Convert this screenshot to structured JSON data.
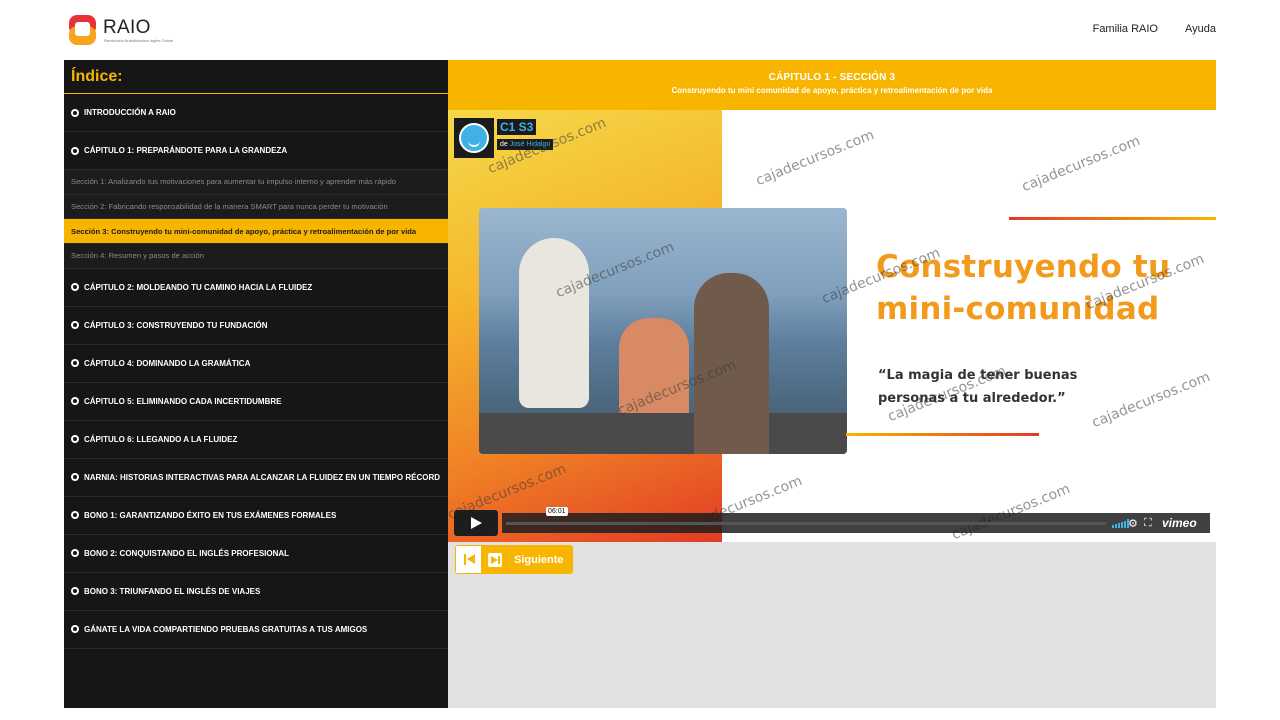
{
  "header": {
    "brand": "RAIO",
    "tagline": "Revolución Autodidáctica Inglés Online",
    "nav": [
      "Familia RAIO",
      "Ayuda"
    ]
  },
  "sidebar": {
    "title": "Índice:",
    "items": [
      {
        "type": "chapter",
        "label": "INTRODUCCIÓN A RAIO"
      },
      {
        "type": "chapter",
        "label": "CÁPITULO 1: PREPARÁNDOTE PARA LA GRANDEZA"
      },
      {
        "type": "section",
        "label": "Sección 1: Analizando tus motivaciones para aumentar tu impulso interno y aprender más rápido"
      },
      {
        "type": "section",
        "label": "Sección 2: Fabricando responsabilidad de la manera SMART para nunca perder tu motivación"
      },
      {
        "type": "section",
        "label": "Sección 3: Construyendo tu mini-comunidad de apoyo, práctica y retroalimentación de por vida",
        "active": true
      },
      {
        "type": "section",
        "label": "Sección 4: Resumen y pasos de acción"
      },
      {
        "type": "chapter",
        "label": "CÁPITULO 2: MOLDEANDO TU CAMINO HACIA LA FLUIDEZ"
      },
      {
        "type": "chapter",
        "label": "CÁPITULO 3: CONSTRUYENDO TU FUNDACIÓN"
      },
      {
        "type": "chapter",
        "label": "CÁPITULO 4: DOMINANDO LA GRAMÁTICA"
      },
      {
        "type": "chapter",
        "label": "CÁPITULO 5: ELIMINANDO CADA INCERTIDUMBRE"
      },
      {
        "type": "chapter",
        "label": "CÁPITULO 6: LLEGANDO A LA FLUIDEZ"
      },
      {
        "type": "chapter",
        "label": "NARNIA: HISTORIAS INTERACTIVAS PARA ALCANZAR LA FLUIDEZ EN UN TIEMPO RÉCORD"
      },
      {
        "type": "chapter",
        "label": "BONO 1: GARANTIZANDO ÉXITO EN TUS EXÁMENES FORMALES"
      },
      {
        "type": "chapter",
        "label": "BONO 2: CONQUISTANDO EL INGLÉS PROFESIONAL"
      },
      {
        "type": "chapter",
        "label": "BONO 3: TRIUNFANDO EL INGLÉS DE VIAJES"
      },
      {
        "type": "chapter",
        "label": "GÁNATE LA VIDA COMPARTIENDO PRUEBAS GRATUITAS A TUS AMIGOS"
      }
    ]
  },
  "main": {
    "heading": "CÁPITULO 1 - SECCIÓN 3",
    "subheading": "Construyendo tu mini comunidad de apoyo, práctica y retroalimentación de por vida",
    "video": {
      "badge_title": "C1 S3",
      "badge_by_prefix": "de",
      "badge_author": "José Hidalgo",
      "slide_title_line1": "Construyendo tu",
      "slide_title_line2": "mini-comunidad",
      "slide_quote_line1": "“La magia de tener buenas",
      "slide_quote_line2": "personas a tu alrededor.”",
      "time": "06:01",
      "player_brand": "vimeo",
      "watermark": "cajadecursos.com"
    },
    "next_label": "Siguiente"
  },
  "colors": {
    "accent": "#f7b500",
    "sidebar_bg": "#161616",
    "player_blue": "#3fb1e5"
  }
}
